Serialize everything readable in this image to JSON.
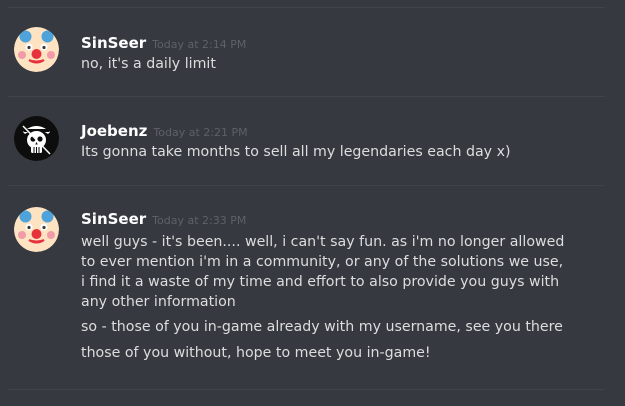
{
  "messages": [
    {
      "username": "SinSeer",
      "timestamp": "Today at 2:14 PM",
      "avatar": "clown-face-icon",
      "lines": [
        "no, it's a daily limit"
      ]
    },
    {
      "username": "Joebenz",
      "timestamp": "Today at 2:21 PM",
      "avatar": "pirate-skull-icon",
      "lines": [
        "Its gonna take months to sell all my legendaries each day x)"
      ]
    },
    {
      "username": "SinSeer",
      "timestamp": "Today at 2:33 PM",
      "avatar": "clown-face-icon",
      "lines": [
        "well guys - it's been.... well, i can't say fun. as i'm no longer allowed to ever mention i'm in a community, or any of the solutions we use, i find it a waste of my time and effort to also provide you guys with any other information",
        "so - those of you in-game already with my username, see you there",
        "those of you without, hope to meet you in-game!"
      ]
    }
  ],
  "colors": {
    "background": "#36393f",
    "username": "#ffffff",
    "timestamp": "#5d6168",
    "message_text": "#dcddde",
    "divider": "#40434a"
  }
}
